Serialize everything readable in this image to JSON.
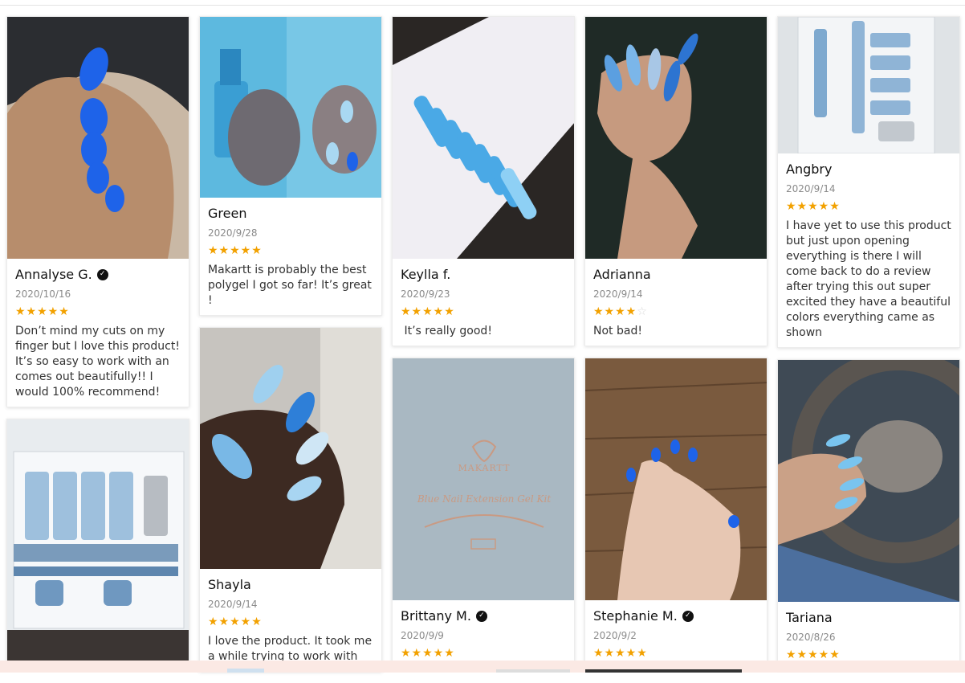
{
  "reviews": [
    {
      "name": "Annalyse G.",
      "date": "2020/10/16",
      "stars": "★★★★★",
      "text": "Don’t mind my cuts on my finger but I love this product! It’s so easy to work with an comes out beautifully!! I would 100% recommend!"
    },
    {
      "name": "Green",
      "date": "2020/9/28",
      "stars": "★★★★★",
      "text": "Makartt is probably the best polygel I got so far! It’s great !"
    },
    {
      "name": "Keylla f.",
      "date": "2020/9/23",
      "stars": "★★★★★",
      "text": " It’s really good!"
    },
    {
      "name": "Adrianna",
      "date": "2020/9/14",
      "stars": "★★★★",
      "stars_off": "☆",
      "text": "Not bad!"
    },
    {
      "name": "Angbry",
      "date": "2020/9/14",
      "stars": "★★★★★",
      "text": "I have yet to use this product but just upon opening everything is there I will come back to do a review after trying this out super excited they have a beautiful colors everything came as shown"
    },
    {
      "name": "Shayla",
      "date": "2020/9/14",
      "stars": "★★★★★",
      "text": "I love the product. It took me a while trying to work with"
    },
    {
      "name": "Brittany M.",
      "date": "2020/9/9",
      "stars": "★★★★★",
      "text": ""
    },
    {
      "name": "Stephanie M.",
      "date": "2020/9/2",
      "stars": "★★★★★",
      "text": ""
    },
    {
      "name": "Tariana",
      "date": "2020/8/26",
      "stars": "★★★★★",
      "text": ""
    }
  ],
  "box_label": "Blue Nail Extension Gel Kit",
  "brand": "MAKARTT",
  "colors": {
    "star": "#f2a100",
    "accent_blue": "#1e63e9",
    "light_blue": "#7ec6f0"
  }
}
